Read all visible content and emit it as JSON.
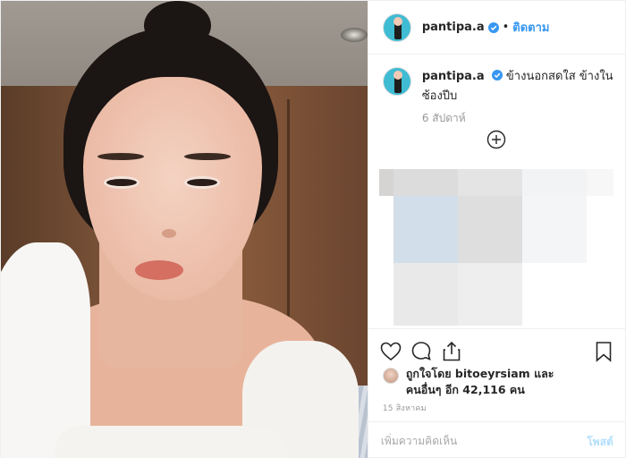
{
  "post": {
    "username": "pantipa.a",
    "follow_label": "ติดตาม",
    "dot": "•",
    "caption": "ข้างนอกสดใส ข้างในซ้องปีบ",
    "caption_time": "6 สัปดาห์",
    "likes": {
      "prefix": "ถูกใจโดย",
      "user": "bitoeyrsiam",
      "and": "และ",
      "others_prefix": "คนอื่นๆ อีก",
      "count": "42,116",
      "suffix": "คน"
    },
    "date": "15 สิงหาคม",
    "comment_placeholder": "เพิ่มความคิดเห็น",
    "post_button": "โพสต์"
  },
  "icons": {
    "verified": "verified-badge-icon",
    "add": "plus-circle-icon",
    "like": "heart-icon",
    "comment": "comment-bubble-icon",
    "share": "share-icon",
    "save": "bookmark-icon"
  },
  "colors": {
    "link": "#3897f0",
    "text": "#262626",
    "muted": "#999999",
    "post_button_disabled": "#b2dffc"
  }
}
